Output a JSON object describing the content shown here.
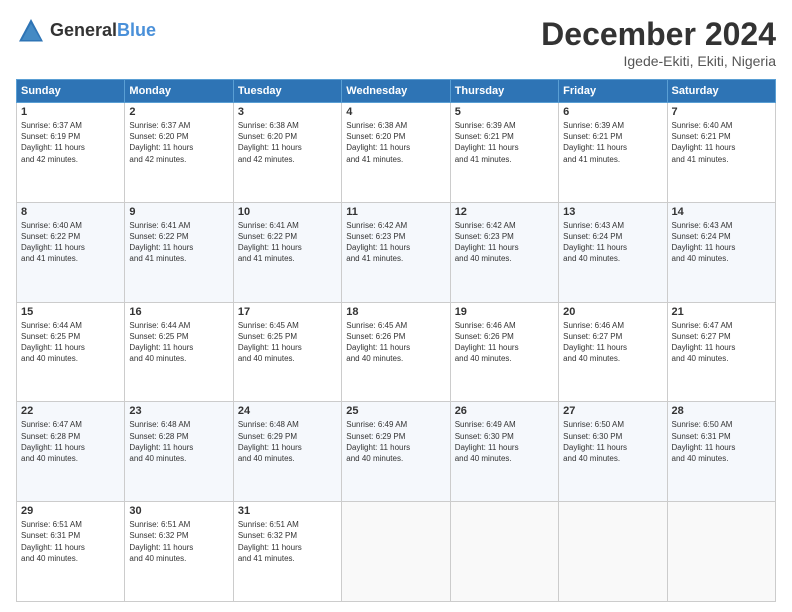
{
  "header": {
    "logo_line1": "General",
    "logo_line2": "Blue",
    "month": "December 2024",
    "location": "Igede-Ekiti, Ekiti, Nigeria"
  },
  "days_of_week": [
    "Sunday",
    "Monday",
    "Tuesday",
    "Wednesday",
    "Thursday",
    "Friday",
    "Saturday"
  ],
  "weeks": [
    [
      {
        "day": "1",
        "lines": [
          "Sunrise: 6:37 AM",
          "Sunset: 6:19 PM",
          "Daylight: 11 hours",
          "and 42 minutes."
        ]
      },
      {
        "day": "2",
        "lines": [
          "Sunrise: 6:37 AM",
          "Sunset: 6:20 PM",
          "Daylight: 11 hours",
          "and 42 minutes."
        ]
      },
      {
        "day": "3",
        "lines": [
          "Sunrise: 6:38 AM",
          "Sunset: 6:20 PM",
          "Daylight: 11 hours",
          "and 42 minutes."
        ]
      },
      {
        "day": "4",
        "lines": [
          "Sunrise: 6:38 AM",
          "Sunset: 6:20 PM",
          "Daylight: 11 hours",
          "and 41 minutes."
        ]
      },
      {
        "day": "5",
        "lines": [
          "Sunrise: 6:39 AM",
          "Sunset: 6:21 PM",
          "Daylight: 11 hours",
          "and 41 minutes."
        ]
      },
      {
        "day": "6",
        "lines": [
          "Sunrise: 6:39 AM",
          "Sunset: 6:21 PM",
          "Daylight: 11 hours",
          "and 41 minutes."
        ]
      },
      {
        "day": "7",
        "lines": [
          "Sunrise: 6:40 AM",
          "Sunset: 6:21 PM",
          "Daylight: 11 hours",
          "and 41 minutes."
        ]
      }
    ],
    [
      {
        "day": "8",
        "lines": [
          "Sunrise: 6:40 AM",
          "Sunset: 6:22 PM",
          "Daylight: 11 hours",
          "and 41 minutes."
        ]
      },
      {
        "day": "9",
        "lines": [
          "Sunrise: 6:41 AM",
          "Sunset: 6:22 PM",
          "Daylight: 11 hours",
          "and 41 minutes."
        ]
      },
      {
        "day": "10",
        "lines": [
          "Sunrise: 6:41 AM",
          "Sunset: 6:22 PM",
          "Daylight: 11 hours",
          "and 41 minutes."
        ]
      },
      {
        "day": "11",
        "lines": [
          "Sunrise: 6:42 AM",
          "Sunset: 6:23 PM",
          "Daylight: 11 hours",
          "and 41 minutes."
        ]
      },
      {
        "day": "12",
        "lines": [
          "Sunrise: 6:42 AM",
          "Sunset: 6:23 PM",
          "Daylight: 11 hours",
          "and 40 minutes."
        ]
      },
      {
        "day": "13",
        "lines": [
          "Sunrise: 6:43 AM",
          "Sunset: 6:24 PM",
          "Daylight: 11 hours",
          "and 40 minutes."
        ]
      },
      {
        "day": "14",
        "lines": [
          "Sunrise: 6:43 AM",
          "Sunset: 6:24 PM",
          "Daylight: 11 hours",
          "and 40 minutes."
        ]
      }
    ],
    [
      {
        "day": "15",
        "lines": [
          "Sunrise: 6:44 AM",
          "Sunset: 6:25 PM",
          "Daylight: 11 hours",
          "and 40 minutes."
        ]
      },
      {
        "day": "16",
        "lines": [
          "Sunrise: 6:44 AM",
          "Sunset: 6:25 PM",
          "Daylight: 11 hours",
          "and 40 minutes."
        ]
      },
      {
        "day": "17",
        "lines": [
          "Sunrise: 6:45 AM",
          "Sunset: 6:25 PM",
          "Daylight: 11 hours",
          "and 40 minutes."
        ]
      },
      {
        "day": "18",
        "lines": [
          "Sunrise: 6:45 AM",
          "Sunset: 6:26 PM",
          "Daylight: 11 hours",
          "and 40 minutes."
        ]
      },
      {
        "day": "19",
        "lines": [
          "Sunrise: 6:46 AM",
          "Sunset: 6:26 PM",
          "Daylight: 11 hours",
          "and 40 minutes."
        ]
      },
      {
        "day": "20",
        "lines": [
          "Sunrise: 6:46 AM",
          "Sunset: 6:27 PM",
          "Daylight: 11 hours",
          "and 40 minutes."
        ]
      },
      {
        "day": "21",
        "lines": [
          "Sunrise: 6:47 AM",
          "Sunset: 6:27 PM",
          "Daylight: 11 hours",
          "and 40 minutes."
        ]
      }
    ],
    [
      {
        "day": "22",
        "lines": [
          "Sunrise: 6:47 AM",
          "Sunset: 6:28 PM",
          "Daylight: 11 hours",
          "and 40 minutes."
        ]
      },
      {
        "day": "23",
        "lines": [
          "Sunrise: 6:48 AM",
          "Sunset: 6:28 PM",
          "Daylight: 11 hours",
          "and 40 minutes."
        ]
      },
      {
        "day": "24",
        "lines": [
          "Sunrise: 6:48 AM",
          "Sunset: 6:29 PM",
          "Daylight: 11 hours",
          "and 40 minutes."
        ]
      },
      {
        "day": "25",
        "lines": [
          "Sunrise: 6:49 AM",
          "Sunset: 6:29 PM",
          "Daylight: 11 hours",
          "and 40 minutes."
        ]
      },
      {
        "day": "26",
        "lines": [
          "Sunrise: 6:49 AM",
          "Sunset: 6:30 PM",
          "Daylight: 11 hours",
          "and 40 minutes."
        ]
      },
      {
        "day": "27",
        "lines": [
          "Sunrise: 6:50 AM",
          "Sunset: 6:30 PM",
          "Daylight: 11 hours",
          "and 40 minutes."
        ]
      },
      {
        "day": "28",
        "lines": [
          "Sunrise: 6:50 AM",
          "Sunset: 6:31 PM",
          "Daylight: 11 hours",
          "and 40 minutes."
        ]
      }
    ],
    [
      {
        "day": "29",
        "lines": [
          "Sunrise: 6:51 AM",
          "Sunset: 6:31 PM",
          "Daylight: 11 hours",
          "and 40 minutes."
        ]
      },
      {
        "day": "30",
        "lines": [
          "Sunrise: 6:51 AM",
          "Sunset: 6:32 PM",
          "Daylight: 11 hours",
          "and 40 minutes."
        ]
      },
      {
        "day": "31",
        "lines": [
          "Sunrise: 6:51 AM",
          "Sunset: 6:32 PM",
          "Daylight: 11 hours",
          "and 41 minutes."
        ]
      },
      {
        "day": "",
        "lines": []
      },
      {
        "day": "",
        "lines": []
      },
      {
        "day": "",
        "lines": []
      },
      {
        "day": "",
        "lines": []
      }
    ]
  ]
}
